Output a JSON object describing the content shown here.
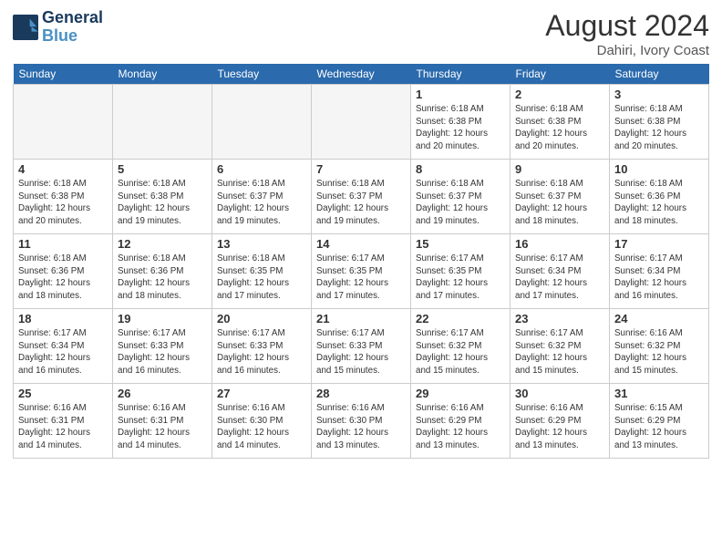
{
  "logo": {
    "line1": "General",
    "line2": "Blue"
  },
  "title": {
    "month_year": "August 2024",
    "location": "Dahiri, Ivory Coast"
  },
  "weekdays": [
    "Sunday",
    "Monday",
    "Tuesday",
    "Wednesday",
    "Thursday",
    "Friday",
    "Saturday"
  ],
  "weeks": [
    [
      {
        "day": "",
        "info": ""
      },
      {
        "day": "",
        "info": ""
      },
      {
        "day": "",
        "info": ""
      },
      {
        "day": "",
        "info": ""
      },
      {
        "day": "1",
        "info": "Sunrise: 6:18 AM\nSunset: 6:38 PM\nDaylight: 12 hours\nand 20 minutes."
      },
      {
        "day": "2",
        "info": "Sunrise: 6:18 AM\nSunset: 6:38 PM\nDaylight: 12 hours\nand 20 minutes."
      },
      {
        "day": "3",
        "info": "Sunrise: 6:18 AM\nSunset: 6:38 PM\nDaylight: 12 hours\nand 20 minutes."
      }
    ],
    [
      {
        "day": "4",
        "info": "Sunrise: 6:18 AM\nSunset: 6:38 PM\nDaylight: 12 hours\nand 20 minutes."
      },
      {
        "day": "5",
        "info": "Sunrise: 6:18 AM\nSunset: 6:38 PM\nDaylight: 12 hours\nand 19 minutes."
      },
      {
        "day": "6",
        "info": "Sunrise: 6:18 AM\nSunset: 6:37 PM\nDaylight: 12 hours\nand 19 minutes."
      },
      {
        "day": "7",
        "info": "Sunrise: 6:18 AM\nSunset: 6:37 PM\nDaylight: 12 hours\nand 19 minutes."
      },
      {
        "day": "8",
        "info": "Sunrise: 6:18 AM\nSunset: 6:37 PM\nDaylight: 12 hours\nand 19 minutes."
      },
      {
        "day": "9",
        "info": "Sunrise: 6:18 AM\nSunset: 6:37 PM\nDaylight: 12 hours\nand 18 minutes."
      },
      {
        "day": "10",
        "info": "Sunrise: 6:18 AM\nSunset: 6:36 PM\nDaylight: 12 hours\nand 18 minutes."
      }
    ],
    [
      {
        "day": "11",
        "info": "Sunrise: 6:18 AM\nSunset: 6:36 PM\nDaylight: 12 hours\nand 18 minutes."
      },
      {
        "day": "12",
        "info": "Sunrise: 6:18 AM\nSunset: 6:36 PM\nDaylight: 12 hours\nand 18 minutes."
      },
      {
        "day": "13",
        "info": "Sunrise: 6:18 AM\nSunset: 6:35 PM\nDaylight: 12 hours\nand 17 minutes."
      },
      {
        "day": "14",
        "info": "Sunrise: 6:17 AM\nSunset: 6:35 PM\nDaylight: 12 hours\nand 17 minutes."
      },
      {
        "day": "15",
        "info": "Sunrise: 6:17 AM\nSunset: 6:35 PM\nDaylight: 12 hours\nand 17 minutes."
      },
      {
        "day": "16",
        "info": "Sunrise: 6:17 AM\nSunset: 6:34 PM\nDaylight: 12 hours\nand 17 minutes."
      },
      {
        "day": "17",
        "info": "Sunrise: 6:17 AM\nSunset: 6:34 PM\nDaylight: 12 hours\nand 16 minutes."
      }
    ],
    [
      {
        "day": "18",
        "info": "Sunrise: 6:17 AM\nSunset: 6:34 PM\nDaylight: 12 hours\nand 16 minutes."
      },
      {
        "day": "19",
        "info": "Sunrise: 6:17 AM\nSunset: 6:33 PM\nDaylight: 12 hours\nand 16 minutes."
      },
      {
        "day": "20",
        "info": "Sunrise: 6:17 AM\nSunset: 6:33 PM\nDaylight: 12 hours\nand 16 minutes."
      },
      {
        "day": "21",
        "info": "Sunrise: 6:17 AM\nSunset: 6:33 PM\nDaylight: 12 hours\nand 15 minutes."
      },
      {
        "day": "22",
        "info": "Sunrise: 6:17 AM\nSunset: 6:32 PM\nDaylight: 12 hours\nand 15 minutes."
      },
      {
        "day": "23",
        "info": "Sunrise: 6:17 AM\nSunset: 6:32 PM\nDaylight: 12 hours\nand 15 minutes."
      },
      {
        "day": "24",
        "info": "Sunrise: 6:16 AM\nSunset: 6:32 PM\nDaylight: 12 hours\nand 15 minutes."
      }
    ],
    [
      {
        "day": "25",
        "info": "Sunrise: 6:16 AM\nSunset: 6:31 PM\nDaylight: 12 hours\nand 14 minutes."
      },
      {
        "day": "26",
        "info": "Sunrise: 6:16 AM\nSunset: 6:31 PM\nDaylight: 12 hours\nand 14 minutes."
      },
      {
        "day": "27",
        "info": "Sunrise: 6:16 AM\nSunset: 6:30 PM\nDaylight: 12 hours\nand 14 minutes."
      },
      {
        "day": "28",
        "info": "Sunrise: 6:16 AM\nSunset: 6:30 PM\nDaylight: 12 hours\nand 13 minutes."
      },
      {
        "day": "29",
        "info": "Sunrise: 6:16 AM\nSunset: 6:29 PM\nDaylight: 12 hours\nand 13 minutes."
      },
      {
        "day": "30",
        "info": "Sunrise: 6:16 AM\nSunset: 6:29 PM\nDaylight: 12 hours\nand 13 minutes."
      },
      {
        "day": "31",
        "info": "Sunrise: 6:15 AM\nSunset: 6:29 PM\nDaylight: 12 hours\nand 13 minutes."
      }
    ]
  ]
}
